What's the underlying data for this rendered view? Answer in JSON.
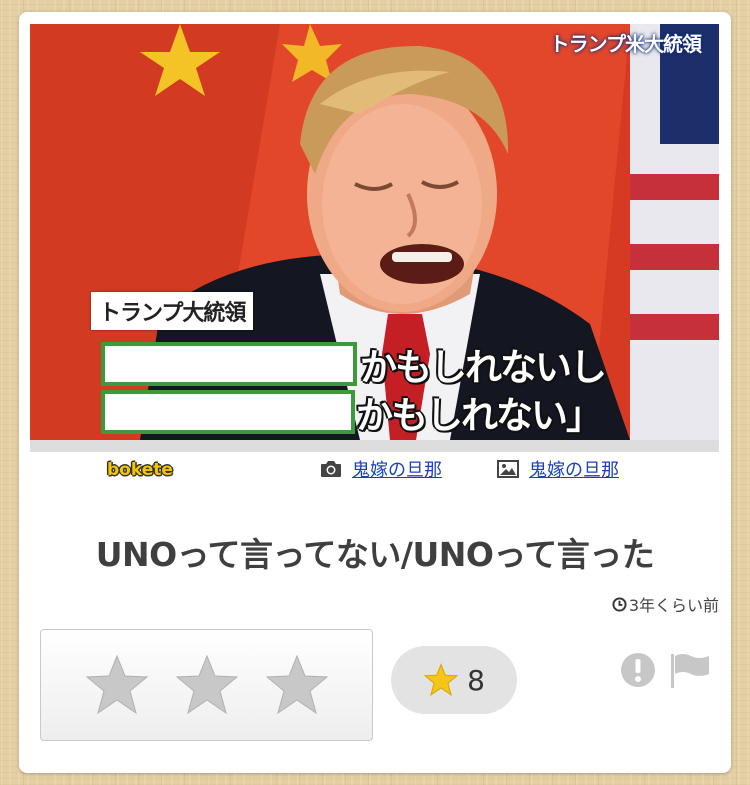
{
  "photo": {
    "top_tag": "トランプ米大統領",
    "name_tag": "トランプ大統領",
    "subtitle_line1": "かもしれないし",
    "subtitle_line2": "かもしれない」"
  },
  "meta": {
    "logo": "bokete",
    "photo_author": "鬼嫁の旦那",
    "image_author": "鬼嫁の旦那",
    "icons": [
      "camera-icon",
      "image-icon"
    ]
  },
  "post": {
    "title": "UNOって言ってない/UNOって言った",
    "timestamp": "3年くらい前"
  },
  "rating": {
    "star_count": 3,
    "score": "8"
  },
  "colors": {
    "accent_green": "#3d9a3b",
    "link_blue": "#1c3fbd",
    "star_gold": "#f5c518",
    "star_gray": "#c8c8c8"
  }
}
